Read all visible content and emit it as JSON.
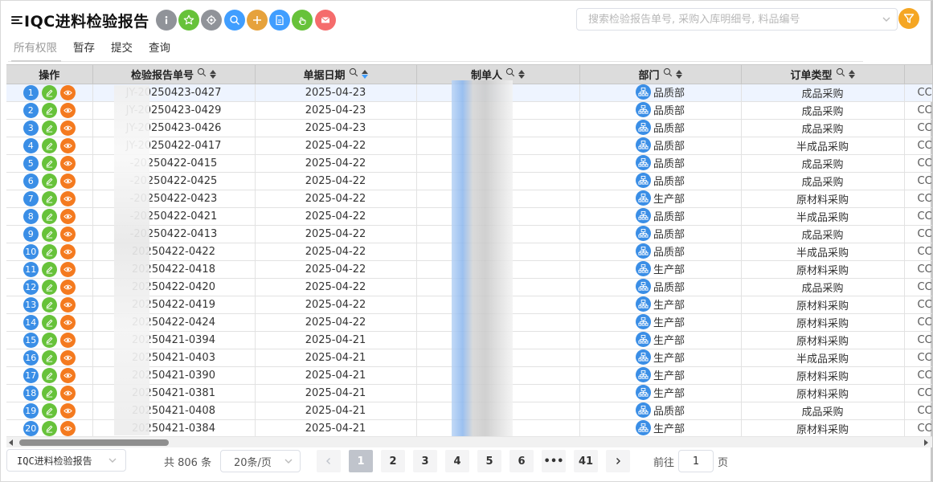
{
  "header": {
    "title": "IQC进料检验报告",
    "toolbar_icons": [
      {
        "name": "info-icon",
        "color": "#909399"
      },
      {
        "name": "star-icon",
        "color": "#67c23a"
      },
      {
        "name": "settings-icon",
        "color": "#909399"
      },
      {
        "name": "search-icon",
        "color": "#409eff"
      },
      {
        "name": "add-icon",
        "color": "#e6a23c"
      },
      {
        "name": "document-icon",
        "color": "#409eff"
      },
      {
        "name": "hand-icon",
        "color": "#67c23a"
      },
      {
        "name": "mail-icon",
        "color": "#f56c6c"
      }
    ],
    "search_placeholder": "搜索检验报告单号, 采购入库明细号, 料品编号",
    "filter_color": "#f5a623"
  },
  "tabs": [
    {
      "label": "所有权限",
      "active": true
    },
    {
      "label": "暂存",
      "active": false
    },
    {
      "label": "提交",
      "active": false
    },
    {
      "label": "查询",
      "active": false
    }
  ],
  "table": {
    "columns": [
      {
        "key": "op",
        "label": "操作",
        "search": false,
        "sort": false
      },
      {
        "key": "no",
        "label": "检验报告单号",
        "search": true,
        "sort": true
      },
      {
        "key": "date",
        "label": "单据日期",
        "search": true,
        "sort": true
      },
      {
        "key": "maker",
        "label": "制单人",
        "search": true,
        "sort": true
      },
      {
        "key": "dept",
        "label": "部门",
        "search": true,
        "sort": true
      },
      {
        "key": "type",
        "label": "订单类型",
        "search": true,
        "sort": true
      },
      {
        "key": "extra",
        "label": "",
        "search": false,
        "sort": false
      }
    ],
    "rows": [
      {
        "n": "1",
        "no": "JY-20250423-0427",
        "date": "2025-04-23",
        "dept": "品质部",
        "type": "成品采购",
        "extra": "CC"
      },
      {
        "n": "2",
        "no": "JY-20250423-0429",
        "date": "2025-04-23",
        "dept": "品质部",
        "type": "成品采购",
        "extra": "CC"
      },
      {
        "n": "3",
        "no": "JY-20250423-0426",
        "date": "2025-04-23",
        "dept": "品质部",
        "type": "成品采购",
        "extra": "CC"
      },
      {
        "n": "4",
        "no": "JY-20250422-0417",
        "date": "2025-04-22",
        "dept": "品质部",
        "type": "半成品采购",
        "extra": "CC"
      },
      {
        "n": "5",
        "no": "-20250422-0415",
        "date": "2025-04-22",
        "dept": "品质部",
        "type": "成品采购",
        "extra": "CC"
      },
      {
        "n": "6",
        "no": "-20250422-0425",
        "date": "2025-04-22",
        "dept": "品质部",
        "type": "成品采购",
        "extra": "CC"
      },
      {
        "n": "7",
        "no": "-20250422-0423",
        "date": "2025-04-22",
        "dept": "生产部",
        "type": "原材料采购",
        "extra": "CC"
      },
      {
        "n": "8",
        "no": "-20250422-0421",
        "date": "2025-04-22",
        "dept": "品质部",
        "type": "半成品采购",
        "extra": "CC"
      },
      {
        "n": "9",
        "no": "-20250422-0413",
        "date": "2025-04-22",
        "dept": "品质部",
        "type": "成品采购",
        "extra": "CC"
      },
      {
        "n": "10",
        "no": "20250422-0422",
        "date": "2025-04-22",
        "dept": "品质部",
        "type": "半成品采购",
        "extra": "CC"
      },
      {
        "n": "11",
        "no": "20250422-0418",
        "date": "2025-04-22",
        "dept": "生产部",
        "type": "原材料采购",
        "extra": "CC"
      },
      {
        "n": "12",
        "no": "20250422-0420",
        "date": "2025-04-22",
        "dept": "品质部",
        "type": "成品采购",
        "extra": "CC"
      },
      {
        "n": "13",
        "no": "20250422-0419",
        "date": "2025-04-22",
        "dept": "生产部",
        "type": "原材料采购",
        "extra": "CC"
      },
      {
        "n": "14",
        "no": "20250422-0424",
        "date": "2025-04-22",
        "dept": "生产部",
        "type": "原材料采购",
        "extra": "CC"
      },
      {
        "n": "15",
        "no": "20250421-0394",
        "date": "2025-04-21",
        "dept": "生产部",
        "type": "原材料采购",
        "extra": "CC"
      },
      {
        "n": "16",
        "no": "20250421-0403",
        "date": "2025-04-21",
        "dept": "生产部",
        "type": "半成品采购",
        "extra": "CC"
      },
      {
        "n": "17",
        "no": "20250421-0390",
        "date": "2025-04-21",
        "dept": "生产部",
        "type": "原材料采购",
        "extra": "CC"
      },
      {
        "n": "18",
        "no": "20250421-0381",
        "date": "2025-04-21",
        "dept": "生产部",
        "type": "原材料采购",
        "extra": "CC"
      },
      {
        "n": "19",
        "no": "20250421-0408",
        "date": "2025-04-21",
        "dept": "品质部",
        "type": "成品采购",
        "extra": "CC"
      },
      {
        "n": "20",
        "no": "20250421-0384",
        "date": "2025-04-21",
        "dept": "生产部",
        "type": "原材料采购",
        "extra": "CC"
      }
    ]
  },
  "footer": {
    "report_select": "IQC进料检验报告",
    "total": "共 806 条",
    "page_size": "20条/页",
    "pages": [
      "1",
      "2",
      "3",
      "4",
      "5",
      "6",
      "•••",
      "41"
    ],
    "current_page": "1",
    "goto_label": "前往",
    "goto_value": "1",
    "goto_suffix": "页"
  }
}
